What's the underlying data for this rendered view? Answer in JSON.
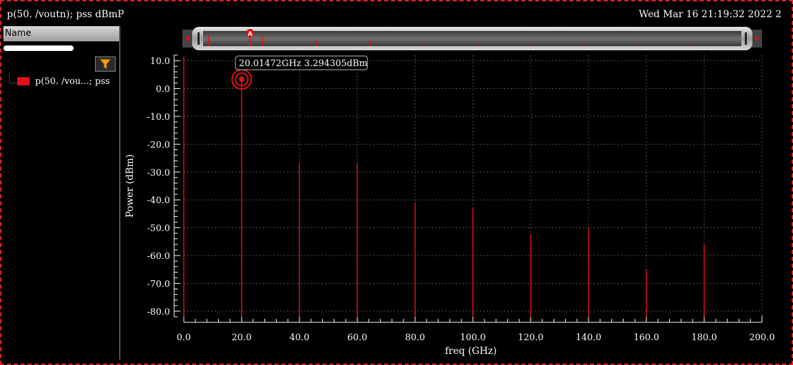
{
  "window": {
    "title": "p(50. /voutn); pss dBmP",
    "datetime": "Wed Mar 16 21:19:32 2022   2"
  },
  "legend_panel": {
    "header": "Name",
    "items": [
      {
        "label": "p(50. /vou...; pss",
        "color": "#e0101a"
      }
    ]
  },
  "marker": {
    "label": "A",
    "readout": "20.01472GHz 3.294305dBm",
    "x": 20.01472,
    "y": 3.294305
  },
  "colors": {
    "trace": "#e0101a",
    "background": "#000000",
    "grid": "#555555",
    "text": "#ffffff"
  },
  "icons": {
    "filter": "funnel-icon",
    "scroll_left": "arrow-left-icon",
    "scroll_right": "arrow-right-icon"
  },
  "chart_data": {
    "type": "bar",
    "xlabel": "freq (GHz)",
    "ylabel": "Power (dBm)",
    "xlim": [
      0,
      200
    ],
    "ylim": [
      -82,
      12
    ],
    "xticks": [
      0,
      20,
      40,
      60,
      80,
      100,
      120,
      140,
      160,
      180,
      200
    ],
    "xtick_labels": [
      "0.0",
      "20.0",
      "40.0",
      "60.0",
      "80.0",
      "100.0",
      "120.0",
      "140.0",
      "160.0",
      "180.0",
      "200.0"
    ],
    "yticks": [
      10,
      0,
      -10,
      -20,
      -30,
      -40,
      -50,
      -60,
      -70,
      -80
    ],
    "ytick_labels": [
      "10.0",
      "0.0",
      "-10.0",
      "-20.0",
      "-30.0",
      "-40.0",
      "-50.0",
      "-60.0",
      "-70.0",
      "-80.0"
    ],
    "grid": true,
    "baseline": -82,
    "series": [
      {
        "name": "p(50. /vou...; pss",
        "color": "#e0101a",
        "x": [
          0,
          20,
          40,
          60,
          80,
          100,
          120,
          140,
          160,
          180
        ],
        "values": [
          11.5,
          3.3,
          -26.5,
          -27.0,
          -41.0,
          -43.0,
          -52.5,
          -50.0,
          -65.0,
          -56.0
        ]
      }
    ]
  }
}
